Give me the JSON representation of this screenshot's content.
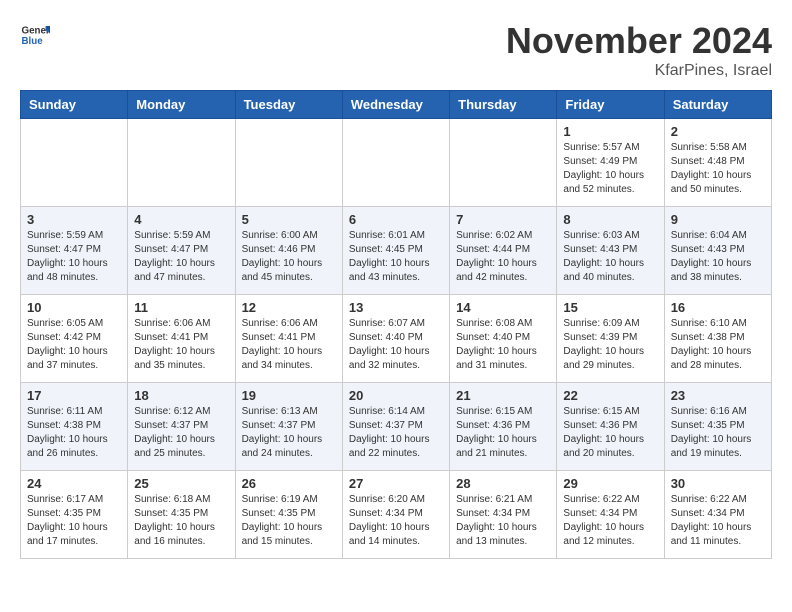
{
  "header": {
    "logo_general": "General",
    "logo_blue": "Blue",
    "month_title": "November 2024",
    "location": "KfarPines, Israel"
  },
  "days_of_week": [
    "Sunday",
    "Monday",
    "Tuesday",
    "Wednesday",
    "Thursday",
    "Friday",
    "Saturday"
  ],
  "weeks": [
    [
      {
        "day": "",
        "info": ""
      },
      {
        "day": "",
        "info": ""
      },
      {
        "day": "",
        "info": ""
      },
      {
        "day": "",
        "info": ""
      },
      {
        "day": "",
        "info": ""
      },
      {
        "day": "1",
        "info": "Sunrise: 5:57 AM\nSunset: 4:49 PM\nDaylight: 10 hours and 52 minutes."
      },
      {
        "day": "2",
        "info": "Sunrise: 5:58 AM\nSunset: 4:48 PM\nDaylight: 10 hours and 50 minutes."
      }
    ],
    [
      {
        "day": "3",
        "info": "Sunrise: 5:59 AM\nSunset: 4:47 PM\nDaylight: 10 hours and 48 minutes."
      },
      {
        "day": "4",
        "info": "Sunrise: 5:59 AM\nSunset: 4:47 PM\nDaylight: 10 hours and 47 minutes."
      },
      {
        "day": "5",
        "info": "Sunrise: 6:00 AM\nSunset: 4:46 PM\nDaylight: 10 hours and 45 minutes."
      },
      {
        "day": "6",
        "info": "Sunrise: 6:01 AM\nSunset: 4:45 PM\nDaylight: 10 hours and 43 minutes."
      },
      {
        "day": "7",
        "info": "Sunrise: 6:02 AM\nSunset: 4:44 PM\nDaylight: 10 hours and 42 minutes."
      },
      {
        "day": "8",
        "info": "Sunrise: 6:03 AM\nSunset: 4:43 PM\nDaylight: 10 hours and 40 minutes."
      },
      {
        "day": "9",
        "info": "Sunrise: 6:04 AM\nSunset: 4:43 PM\nDaylight: 10 hours and 38 minutes."
      }
    ],
    [
      {
        "day": "10",
        "info": "Sunrise: 6:05 AM\nSunset: 4:42 PM\nDaylight: 10 hours and 37 minutes."
      },
      {
        "day": "11",
        "info": "Sunrise: 6:06 AM\nSunset: 4:41 PM\nDaylight: 10 hours and 35 minutes."
      },
      {
        "day": "12",
        "info": "Sunrise: 6:06 AM\nSunset: 4:41 PM\nDaylight: 10 hours and 34 minutes."
      },
      {
        "day": "13",
        "info": "Sunrise: 6:07 AM\nSunset: 4:40 PM\nDaylight: 10 hours and 32 minutes."
      },
      {
        "day": "14",
        "info": "Sunrise: 6:08 AM\nSunset: 4:40 PM\nDaylight: 10 hours and 31 minutes."
      },
      {
        "day": "15",
        "info": "Sunrise: 6:09 AM\nSunset: 4:39 PM\nDaylight: 10 hours and 29 minutes."
      },
      {
        "day": "16",
        "info": "Sunrise: 6:10 AM\nSunset: 4:38 PM\nDaylight: 10 hours and 28 minutes."
      }
    ],
    [
      {
        "day": "17",
        "info": "Sunrise: 6:11 AM\nSunset: 4:38 PM\nDaylight: 10 hours and 26 minutes."
      },
      {
        "day": "18",
        "info": "Sunrise: 6:12 AM\nSunset: 4:37 PM\nDaylight: 10 hours and 25 minutes."
      },
      {
        "day": "19",
        "info": "Sunrise: 6:13 AM\nSunset: 4:37 PM\nDaylight: 10 hours and 24 minutes."
      },
      {
        "day": "20",
        "info": "Sunrise: 6:14 AM\nSunset: 4:37 PM\nDaylight: 10 hours and 22 minutes."
      },
      {
        "day": "21",
        "info": "Sunrise: 6:15 AM\nSunset: 4:36 PM\nDaylight: 10 hours and 21 minutes."
      },
      {
        "day": "22",
        "info": "Sunrise: 6:15 AM\nSunset: 4:36 PM\nDaylight: 10 hours and 20 minutes."
      },
      {
        "day": "23",
        "info": "Sunrise: 6:16 AM\nSunset: 4:35 PM\nDaylight: 10 hours and 19 minutes."
      }
    ],
    [
      {
        "day": "24",
        "info": "Sunrise: 6:17 AM\nSunset: 4:35 PM\nDaylight: 10 hours and 17 minutes."
      },
      {
        "day": "25",
        "info": "Sunrise: 6:18 AM\nSunset: 4:35 PM\nDaylight: 10 hours and 16 minutes."
      },
      {
        "day": "26",
        "info": "Sunrise: 6:19 AM\nSunset: 4:35 PM\nDaylight: 10 hours and 15 minutes."
      },
      {
        "day": "27",
        "info": "Sunrise: 6:20 AM\nSunset: 4:34 PM\nDaylight: 10 hours and 14 minutes."
      },
      {
        "day": "28",
        "info": "Sunrise: 6:21 AM\nSunset: 4:34 PM\nDaylight: 10 hours and 13 minutes."
      },
      {
        "day": "29",
        "info": "Sunrise: 6:22 AM\nSunset: 4:34 PM\nDaylight: 10 hours and 12 minutes."
      },
      {
        "day": "30",
        "info": "Sunrise: 6:22 AM\nSunset: 4:34 PM\nDaylight: 10 hours and 11 minutes."
      }
    ]
  ]
}
